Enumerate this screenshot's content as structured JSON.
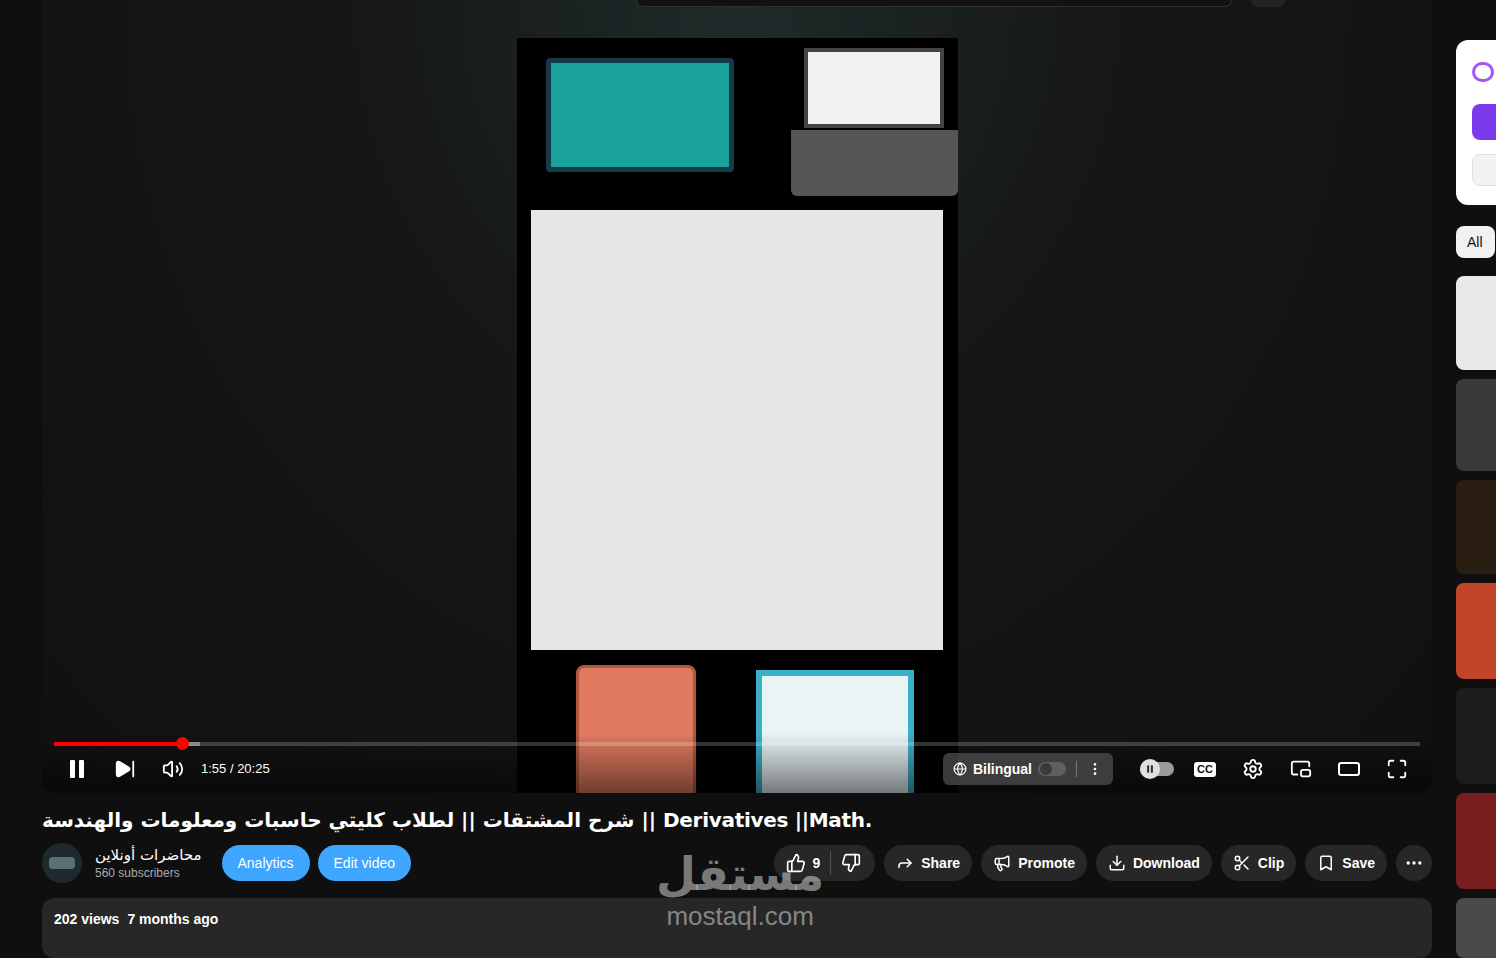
{
  "player": {
    "time": "1:55 / 20:25",
    "playing": true,
    "progress": {
      "level": 0.094,
      "buffered": 0.107
    },
    "bilingual": {
      "label": "Bilingual",
      "on": false
    },
    "autoplay": {
      "on": false
    },
    "captions": {
      "label": "CC"
    }
  },
  "video": {
    "title": "شرح المشتقات || لطلاب كليتي حاسبات ومعلومات والهندسة || Derivatives ||Math."
  },
  "channel": {
    "name": "محاضرات أونلاين",
    "subscribers": "560 subscribers"
  },
  "owner_buttons": [
    "Analytics",
    "Edit video"
  ],
  "actions": {
    "likes": "9",
    "buttons": [
      "Share",
      "Promote",
      "Download",
      "Clip",
      "Save"
    ]
  },
  "description": {
    "views": "202 views",
    "date": "7 months ago"
  },
  "watermark": {
    "arabic": "مستقل",
    "latin": "mostaql.com"
  },
  "sidebar": {
    "chips": [
      {
        "label": "All",
        "selected": true
      }
    ]
  }
}
